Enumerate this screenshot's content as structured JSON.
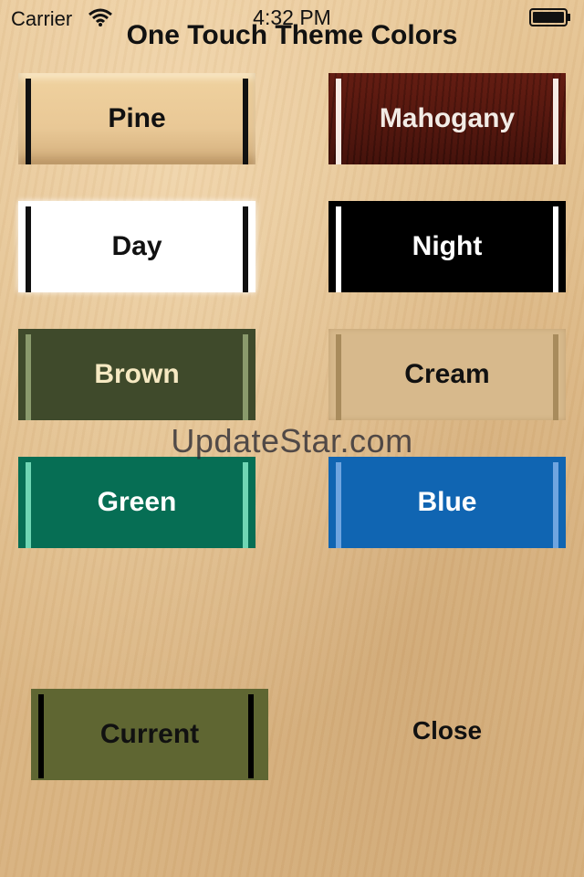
{
  "status_bar": {
    "carrier": "Carrier",
    "time": "4:32 PM",
    "wifi_icon": "wifi-icon",
    "battery_icon": "battery-icon"
  },
  "title": "One Touch Theme Colors",
  "themes": {
    "pine": "Pine",
    "mahogany": "Mahogany",
    "day": "Day",
    "night": "Night",
    "brown": "Brown",
    "cream": "Cream",
    "green": "Green",
    "blue": "Blue"
  },
  "current_label": "Current",
  "close_label": "Close",
  "watermark": "UpdateStar.com",
  "colors": {
    "pine": "#e9c896",
    "mahogany": "#4a140c",
    "day": "#ffffff",
    "night": "#000000",
    "brown": "#3f4a2b",
    "cream": "#d7b98c",
    "green": "#066e54",
    "blue": "#1065b2",
    "current": "#5f6632"
  }
}
